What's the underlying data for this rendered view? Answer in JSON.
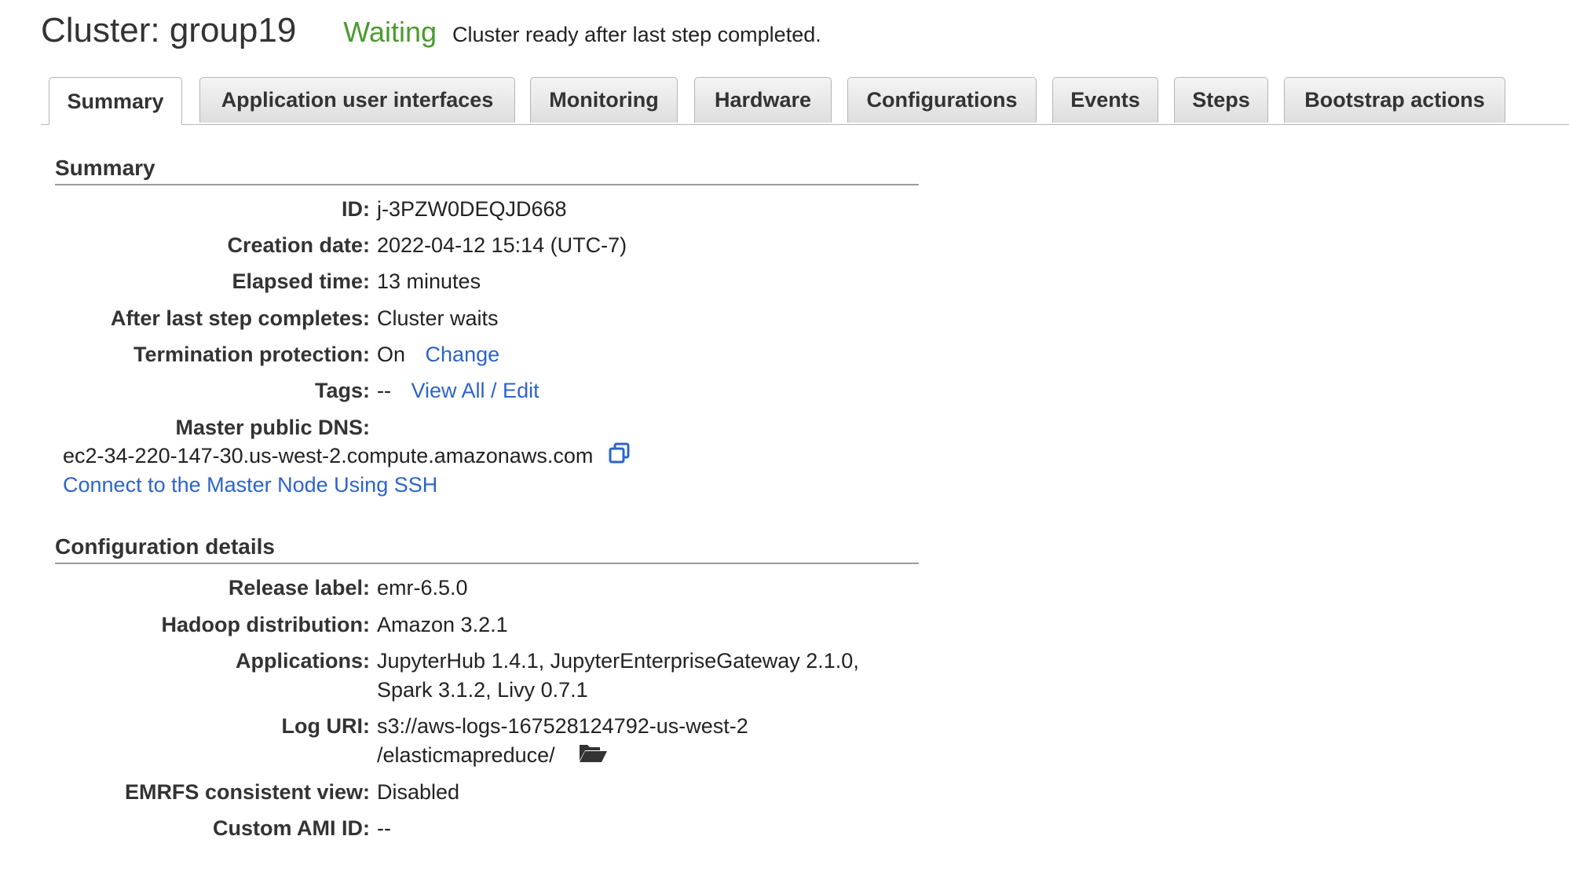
{
  "header": {
    "title": "Cluster: group19",
    "status": "Waiting",
    "status_description": "Cluster ready after last step completed.",
    "status_color": "#4a9a2f"
  },
  "tabs": [
    {
      "label": "Summary",
      "active": true
    },
    {
      "label": "Application user interfaces",
      "active": false
    },
    {
      "label": "Monitoring",
      "active": false
    },
    {
      "label": "Hardware",
      "active": false
    },
    {
      "label": "Configurations",
      "active": false
    },
    {
      "label": "Events",
      "active": false
    },
    {
      "label": "Steps",
      "active": false
    },
    {
      "label": "Bootstrap actions",
      "active": false
    }
  ],
  "summary": {
    "title": "Summary",
    "id_label": "ID:",
    "id_value": "j-3PZW0DEQJD668",
    "creation_label": "Creation date:",
    "creation_value": "2022-04-12 15:14 (UTC-7)",
    "elapsed_label": "Elapsed time:",
    "elapsed_value": "13 minutes",
    "after_label": "After last step completes:",
    "after_value": "Cluster waits",
    "termination_label": "Termination protection:",
    "termination_value": "On",
    "termination_link": "Change",
    "tags_label": "Tags:",
    "tags_value": "--",
    "tags_link": "View All / Edit",
    "dns_label": "Master public DNS:",
    "dns_value": "ec2-34-220-147-30.us-west-2.compute.amazonaws.com",
    "ssh_link": "Connect to the Master Node Using SSH"
  },
  "config": {
    "title": "Configuration details",
    "release_label": "Release label:",
    "release_value": "emr-6.5.0",
    "hadoop_label": "Hadoop distribution:",
    "hadoop_value": "Amazon 3.2.1",
    "apps_label": "Applications:",
    "apps_line1": "JupyterHub 1.4.1, JupyterEnterpriseGateway 2.1.0,",
    "apps_line2": "Spark 3.1.2, Livy 0.7.1",
    "log_label": "Log URI:",
    "log_line1": "s3://aws-logs-167528124792-us-west-2",
    "log_line2": "/elasticmapreduce/",
    "emrfs_label": "EMRFS consistent view:",
    "emrfs_value": "Disabled",
    "ami_label": "Custom AMI ID:",
    "ami_value": "--"
  },
  "colors": {
    "link": "#2c64c8",
    "status_green": "#4a9a2f"
  },
  "icons": {
    "copy": "copy-icon",
    "folder": "folder-open-icon"
  }
}
